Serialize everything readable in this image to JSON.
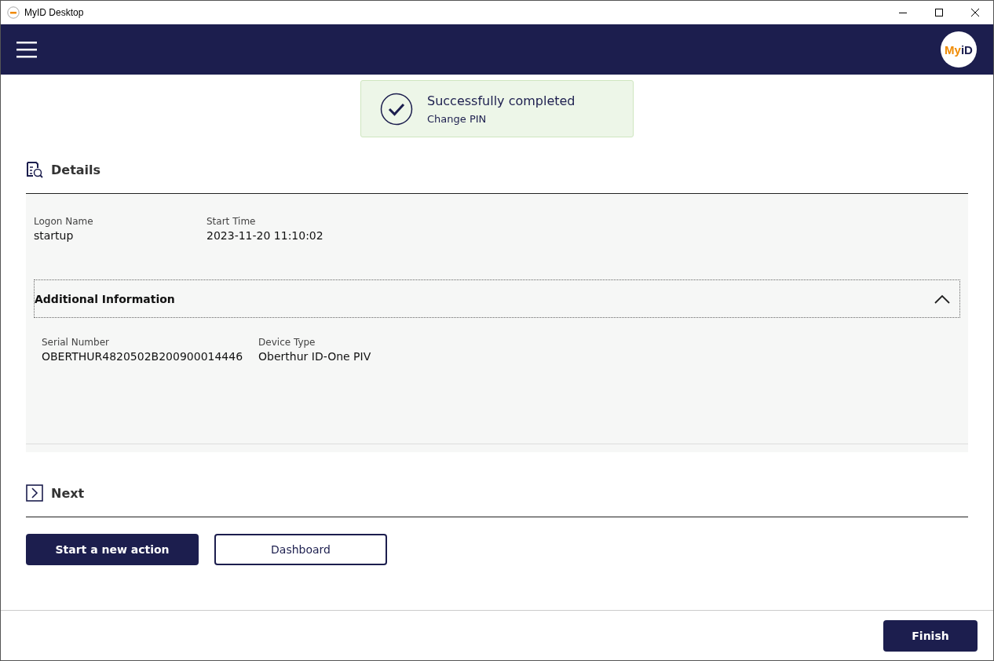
{
  "window": {
    "title": "MyID Desktop"
  },
  "header": {
    "logo": {
      "part_1": "My",
      "part_2": "iD"
    }
  },
  "toast": {
    "title": "Successfully completed",
    "subtitle": "Change PIN"
  },
  "details": {
    "heading": "Details",
    "fields": [
      {
        "label": "Logon Name",
        "value": "startup"
      },
      {
        "label": "Start Time",
        "value": "2023-11-20 11:10:02"
      }
    ],
    "additional": {
      "title": "Additional Information",
      "expanded": true,
      "fields": [
        {
          "label": "Serial Number",
          "value": "OBERTHUR4820502B200900014446"
        },
        {
          "label": "Device Type",
          "value": "Oberthur ID-One PIV"
        }
      ]
    }
  },
  "next": {
    "heading": "Next",
    "buttons": [
      {
        "label": "Start a new action",
        "kind": "primary"
      },
      {
        "label": "Dashboard",
        "kind": "secondary"
      }
    ]
  },
  "footer": {
    "buttons": [
      {
        "label": "Finish",
        "kind": "primary"
      }
    ]
  }
}
